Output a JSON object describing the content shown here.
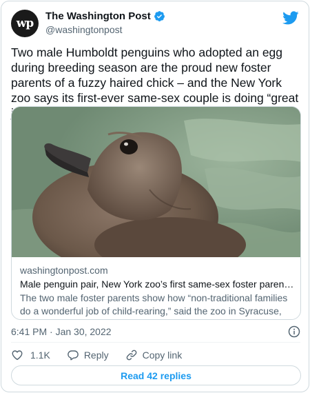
{
  "header": {
    "avatar_text": "wp",
    "display_name": "The Washington Post",
    "handle": "@washingtonpost",
    "verified_icon": "verified-badge-icon",
    "logo_icon": "twitter-bird-icon"
  },
  "tweet": {
    "text": "Two male Humboldt penguins who adopted an egg during breeding season are the proud new foster parents of a fuzzy haired chick – and the New York zoo says its first-ever same-sex couple is doing “great job.”"
  },
  "link_card": {
    "image_alt": "penguin-chick-photo",
    "domain": "washingtonpost.com",
    "title": "Male penguin pair, New York zoo’s first same-sex foster parents, doi…",
    "description": "The two male foster parents show how “non-traditional families do a wonderful job of child-rearing,” said the zoo in Syracuse, N.Y."
  },
  "meta": {
    "timestamp": "6:41 PM · Jan 30, 2022"
  },
  "actions": {
    "like_count": "1.1K",
    "reply_label": "Reply",
    "copy_link_label": "Copy link"
  },
  "replies_button": {
    "label": "Read 42 replies"
  },
  "colors": {
    "accent": "#1d9bf0",
    "secondary_text": "#536471",
    "border": "#cfd9de"
  }
}
